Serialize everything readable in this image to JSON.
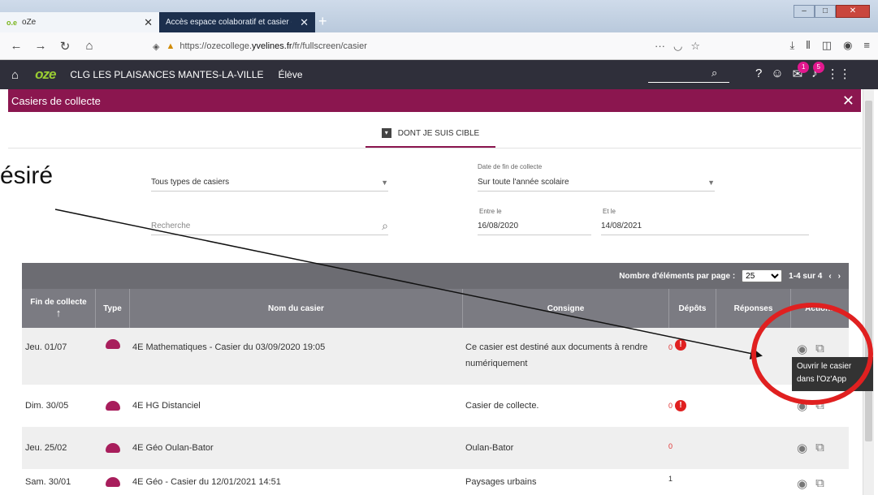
{
  "browser": {
    "tab1_title": "oZe",
    "tab1_favicon": "o.e",
    "tab2_title": "Accès espace colaboratif et casier d",
    "url_prefix": "https://ozecollege.",
    "url_domain": "yvelines.fr",
    "url_path": "/fr/fullscreen/casier",
    "url_menu": "···"
  },
  "app": {
    "school": "CLG LES PLAISANCES MANTES-LA-VILLE",
    "role": "Élève",
    "mail_count": "1",
    "notif_count": "5"
  },
  "page": {
    "title": "Casiers de collecte",
    "tab_label": "DONT JE SUIS CIBLE"
  },
  "filters": {
    "type_value": "Tous types de casiers",
    "search_placeholder": "Recherche",
    "date_label": "Date de fin de collecte",
    "date_value": "Sur toute l'année scolaire",
    "from_label": "Entre le",
    "from_value": "16/08/2020",
    "to_label": "Et le",
    "to_value": "14/08/2021"
  },
  "annotation": {
    "text": "ésiré",
    "colors": {
      "circle": "#e02020",
      "arrow": "#111111"
    }
  },
  "table": {
    "per_page_label": "Nombre d'éléments par page :",
    "per_page_value": "25",
    "range": "1-4 sur 4",
    "headers": {
      "fin": "Fin de collecte",
      "type": "Type",
      "nom": "Nom du casier",
      "consigne": "Consigne",
      "depots": "Dépôts",
      "reponses": "Réponses",
      "actions": "Actions"
    },
    "rows": [
      {
        "fin": "Jeu. 01/07",
        "nom": "4E Mathematiques - Casier du 03/09/2020 19:05",
        "consigne": "Ce casier est destiné aux documents à rendre numériquement",
        "depots": "0"
      },
      {
        "fin": "Dim. 30/05",
        "nom": "4E HG Distanciel",
        "consigne": "Casier de collecte.",
        "depots": "0"
      },
      {
        "fin": "Jeu. 25/02",
        "nom": "4E Géo Oulan-Bator",
        "consigne": "Oulan-Bator",
        "depots": "0"
      },
      {
        "fin": "Sam. 30/01",
        "nom": "4E Géo - Casier du 12/01/2021 14:51",
        "consigne": "Paysages urbains",
        "depots": "1"
      }
    ],
    "tooltip_line1": "Ouvrir le casier",
    "tooltip_line2": "dans l'Oz'App"
  }
}
